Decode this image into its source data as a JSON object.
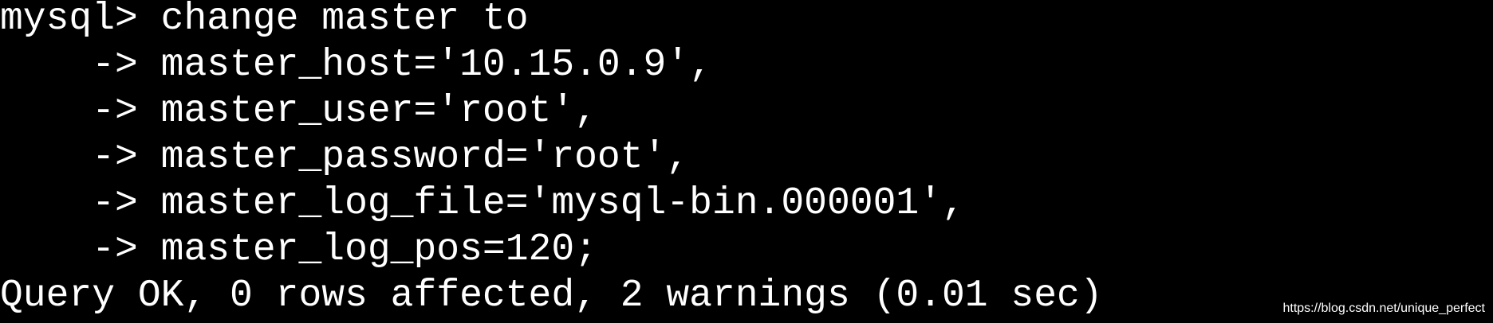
{
  "terminal": {
    "lines": [
      "mysql> change master to",
      "    -> master_host='10.15.0.9',",
      "    -> master_user='root',",
      "    -> master_password='root',",
      "    -> master_log_file='mysql-bin.000001',",
      "    -> master_log_pos=120;",
      "Query OK, 0 rows affected, 2 warnings (0.01 sec)"
    ]
  },
  "watermark": "https://blog.csdn.net/unique_perfect",
  "colors": {
    "background": "#000000",
    "text": "#ffffff"
  }
}
